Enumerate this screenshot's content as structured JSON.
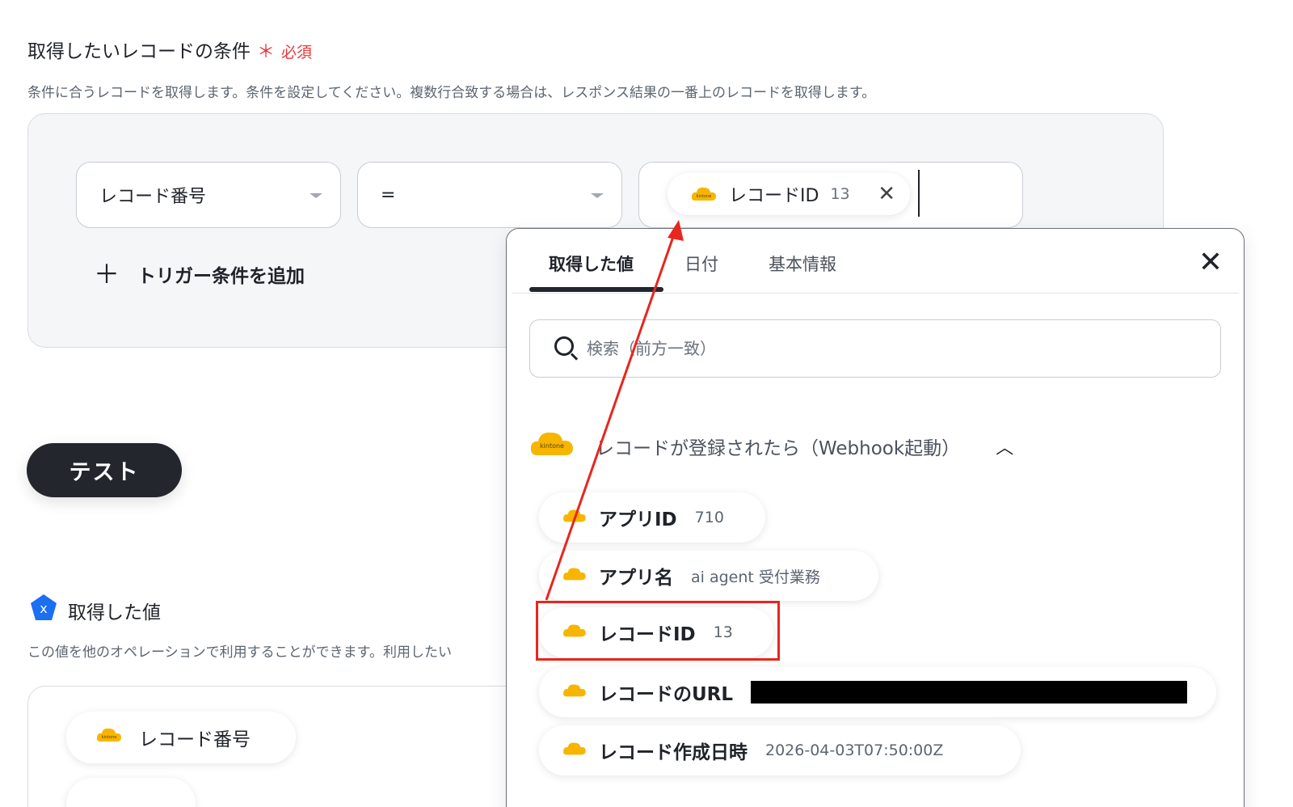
{
  "condition_section": {
    "title": "取得したいレコードの条件",
    "required_star": "＊",
    "required_text": "必須",
    "description": "条件に合うレコードを取得します。条件を設定してください。複数行合致する場合は、レスポンス結果の一番上のレコードを取得します。",
    "field_select": "レコード番号",
    "operator_select": "=",
    "value_chip": {
      "label": "レコードID",
      "value": "13",
      "remove_symbol": "✕"
    },
    "add_trigger_plus": "＋",
    "add_trigger_label": "トリガー条件を追加"
  },
  "test_button": "テスト",
  "acquired_section": {
    "title": "取得した値",
    "description": "この値を他のオペレーションで利用することができます。利用したい",
    "chips": [
      {
        "label": "レコード番号"
      }
    ]
  },
  "dropdown": {
    "tabs": [
      {
        "label": "取得した値",
        "active": true
      },
      {
        "label": "日付",
        "active": false
      },
      {
        "label": "基本情報",
        "active": false
      }
    ],
    "close_symbol": "✕",
    "search_placeholder": "検索（前方一致）",
    "group": {
      "logo_text": "kintone",
      "title": "レコードが登録されたら（Webhook起動）",
      "chevron": "︿"
    },
    "items": [
      {
        "name": "アプリID",
        "value": "710"
      },
      {
        "name": "アプリ名",
        "value": "ai agent 受付業務"
      },
      {
        "name": "レコードID",
        "value": "13",
        "highlighted": true
      },
      {
        "name": "レコードのURL",
        "value": "",
        "redacted": true
      },
      {
        "name": "レコード作成日時",
        "value": "2026-04-03T07:50:00Z"
      }
    ]
  },
  "colors": {
    "brand_yellow": "#f7b500",
    "required_red": "#e8383d",
    "annotation_red": "#e8261e",
    "dark": "#23272d",
    "yoom_blue": "#1b6ff2"
  },
  "icons": [
    "kintone-icon",
    "close-icon",
    "search-icon",
    "plus-icon",
    "chevron-up-icon",
    "yoom-icon"
  ]
}
